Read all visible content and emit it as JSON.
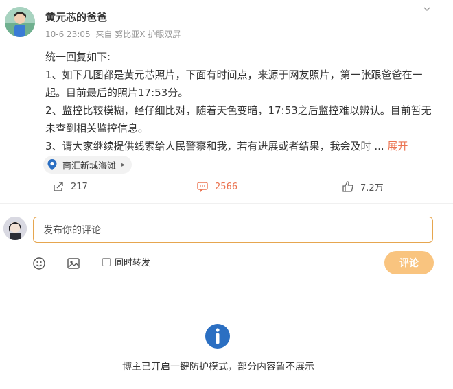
{
  "post": {
    "author": "黄元芯的爸爸",
    "meta": {
      "time": "10-6 23:05",
      "source": "来自 努比亚X 护眼双屏"
    },
    "body": {
      "line1": "统一回复如下:",
      "line2": "1、如下几图都是黄元芯照片，下面有时间点，来源于网友照片，第一张跟爸爸在一起。目前最后的照片17:53分。",
      "line3": "2、监控比较模糊，经仔细比对，随着天色变暗，17:53之后监控难以辨认。目前暂无未查到相关监控信息。",
      "line4": "3、请大家继续提供线索给人民警察和我，若有进展或者结果，我会及时 ...",
      "expand": "展开"
    },
    "location": "南汇新城海滩",
    "actions": {
      "repost_count": "217",
      "comment_count": "2566",
      "like_count": "7.2万"
    }
  },
  "composer": {
    "placeholder": "发布你的评论",
    "repost_label": "同时转发",
    "submit_label": "评论"
  },
  "notice": "博主已开启一键防护模式，部分内容暂不展示",
  "colors": {
    "accent": "#eb7350",
    "submit_bg": "#f9c47f",
    "input_border": "#e6a64f",
    "info_blue": "#2b6fc2"
  }
}
